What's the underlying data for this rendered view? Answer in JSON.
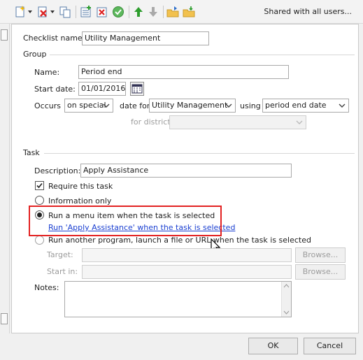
{
  "toolbar": {
    "shared_label": "Shared with all users...",
    "icons": [
      "new-icon",
      "delete-icon",
      "copy-icon",
      "add-task-icon",
      "remove-task-icon",
      "check-icon",
      "move-up-icon",
      "move-down-icon",
      "export-icon",
      "import-icon"
    ]
  },
  "checklist": {
    "name_label": "Checklist name:",
    "name_value": "Utility Management"
  },
  "group": {
    "title": "Group",
    "name_label": "Name:",
    "name_value": "Period end",
    "start_date_label": "Start date:",
    "start_date_value": "01/01/2016",
    "occurs_label": "Occurs",
    "occurs_value": "on special",
    "date_for_label": "date for",
    "date_for_value": "Utility Management",
    "using_label": "using",
    "using_value": "period end date",
    "district_label": "for district",
    "district_value": ""
  },
  "task": {
    "title": "Task",
    "description_label": "Description:",
    "description_value": "Apply Assistance",
    "require_label": "Require this task",
    "info_only_label": "Information only",
    "run_menu_label": "Run a menu item when the task is selected",
    "run_menu_link": "Run 'Apply Assistance' when the task is selected",
    "run_program_label": "Run another program, launch a file or URL when the task is selected",
    "target_label": "Target:",
    "target_value": "",
    "start_in_label": "Start in:",
    "start_in_value": "",
    "browse_label": "Browse...",
    "notes_label": "Notes:",
    "notes_value": ""
  },
  "footer": {
    "ok_label": "OK",
    "cancel_label": "Cancel"
  },
  "colors": {
    "highlight": "#e32222",
    "link": "#1a3fd1",
    "green_arrow": "#2e9e2e"
  }
}
